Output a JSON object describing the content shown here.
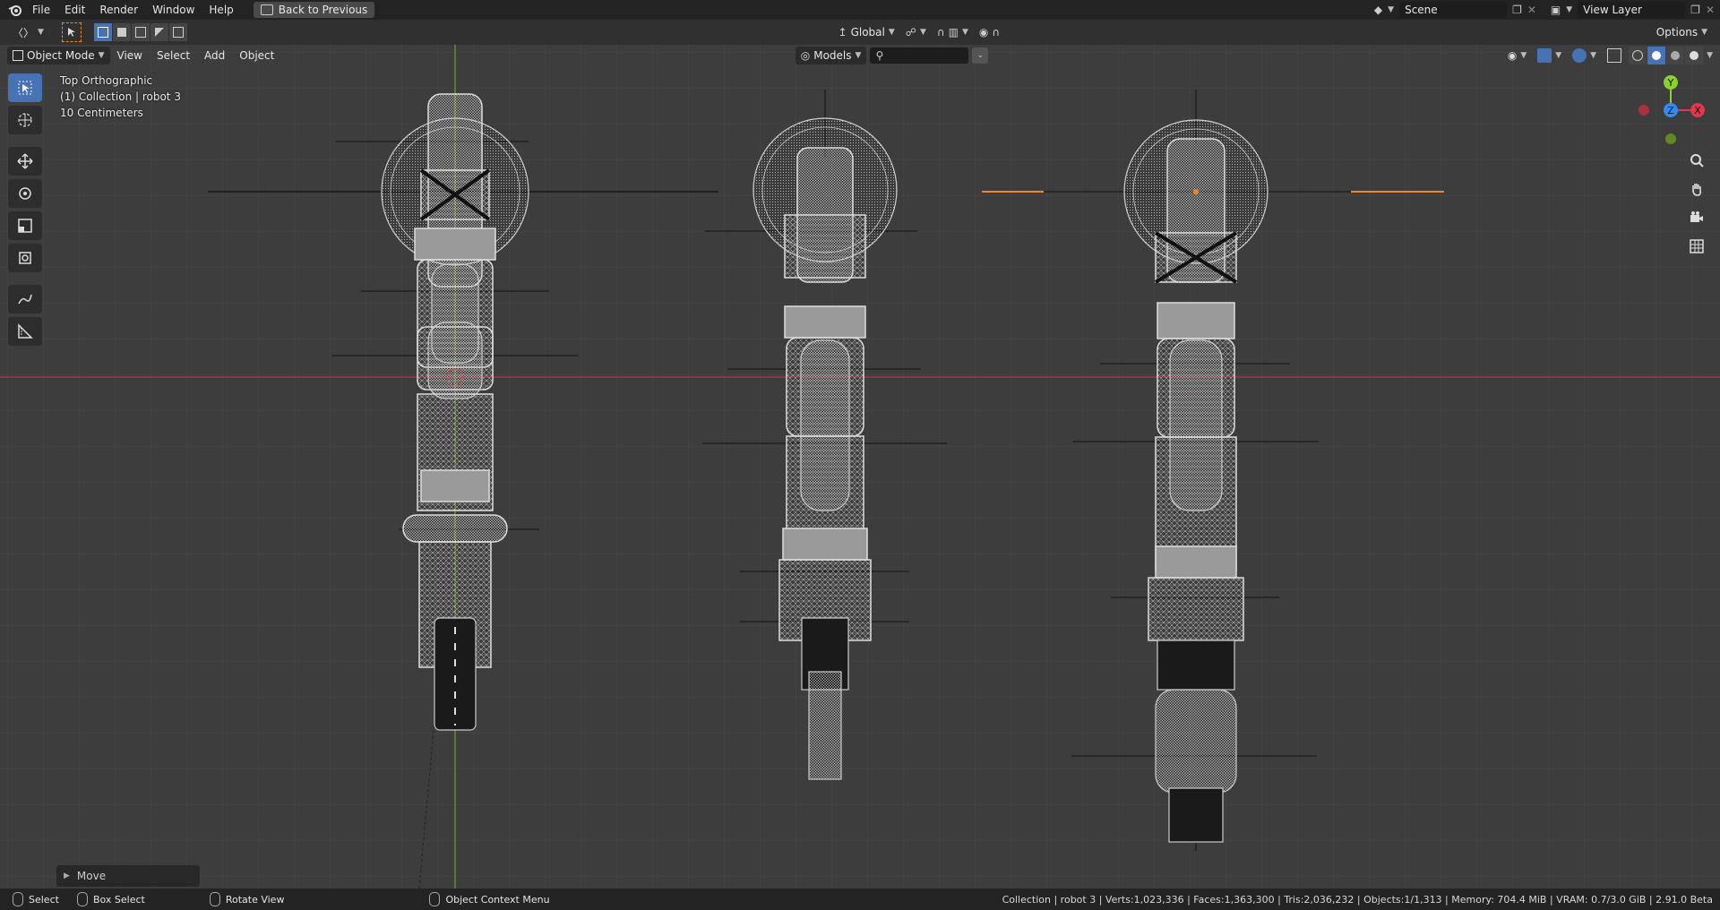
{
  "topbar": {
    "menus": [
      "File",
      "Edit",
      "Render",
      "Window",
      "Help"
    ],
    "back_button": "Back to Previous",
    "scene_label": "Scene",
    "view_layer_label": "View Layer"
  },
  "header": {
    "transform_orientation": "Global",
    "options_label": "Options",
    "collection_dropdown": "Models",
    "search_placeholder": ""
  },
  "viewport_header": {
    "mode": "Object Mode",
    "menus": [
      "View",
      "Select",
      "Add",
      "Object"
    ]
  },
  "overlay": {
    "view_name": "Top Orthographic",
    "collection": "(1) Collection | robot 3",
    "scale": "10 Centimeters"
  },
  "gizmo": {
    "y_label": "Y",
    "z_label": "Z",
    "x_label": "X"
  },
  "last_operator": {
    "label": "Move"
  },
  "statusbar": {
    "select_label": "Select",
    "box_select_label": "Box Select",
    "rotate_label": "Rotate View",
    "context_label": "Object Context Menu",
    "stats": "Collection | robot 3 | Verts:1,023,336 | Faces:1,363,300 | Tris:2,036,232 | Objects:1/1,313 | Memory: 704.4 MiB | VRAM: 0.7/3.0 GiB | 2.91.0 Beta"
  },
  "colors": {
    "accent": "#4772b3",
    "x_axis": "#e0394d",
    "y_axis": "#8cd02e",
    "z_axis": "#2f8cf5",
    "selection_outline": "#e88a2a"
  },
  "icons": {
    "logo": "blender-logo-icon",
    "tools": [
      "select-box-icon",
      "cursor-icon",
      "move-icon",
      "rotate-icon",
      "scale-icon",
      "transform-icon",
      "annotate-icon",
      "measure-icon"
    ],
    "nav": [
      "zoom-icon",
      "hand-icon",
      "camera-icon",
      "grid-icon"
    ]
  }
}
